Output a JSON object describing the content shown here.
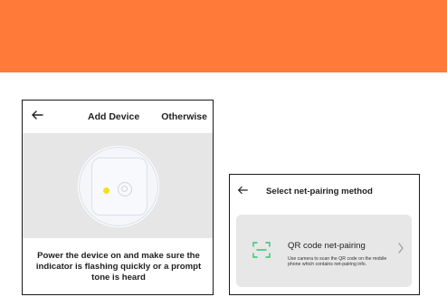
{
  "colors": {
    "banner": "#ff7a38",
    "indicator": "#f5e01a",
    "qr_icon": "#2fc76b"
  },
  "add_device": {
    "back_icon": "arrow-left-icon",
    "title": "Add Device",
    "otherwise": "Otherwise",
    "instruction": "Power the device on and make sure the indicator is flashing quickly or a prompt tone is heard"
  },
  "net_pairing": {
    "back_icon": "arrow-left-icon",
    "title": "Select net-pairing method",
    "options": [
      {
        "icon": "qr-scan-icon",
        "title": "QR code net-pairing",
        "description": "Use camera to scan the QR code on the mobile phone which contains net-pairing info.",
        "chevron": "chevron-right-icon"
      }
    ]
  }
}
